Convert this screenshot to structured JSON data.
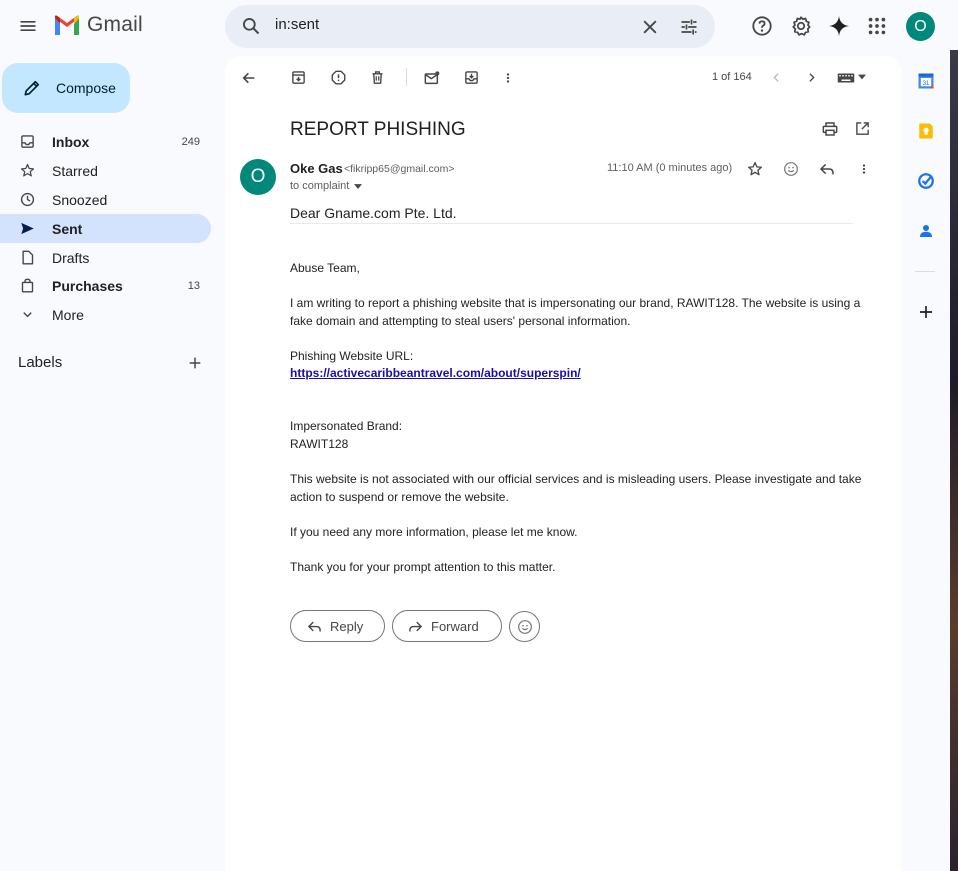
{
  "app": {
    "name": "Gmail"
  },
  "search": {
    "value": "in:sent"
  },
  "user": {
    "initial": "O"
  },
  "compose": {
    "label": "Compose"
  },
  "sidebar": {
    "items": [
      {
        "label": "Inbox",
        "count": "249"
      },
      {
        "label": "Starred",
        "count": ""
      },
      {
        "label": "Snoozed",
        "count": ""
      },
      {
        "label": "Sent",
        "count": ""
      },
      {
        "label": "Drafts",
        "count": ""
      },
      {
        "label": "Purchases",
        "count": "13"
      },
      {
        "label": "More",
        "count": ""
      }
    ],
    "labels_title": "Labels"
  },
  "toolbar": {
    "pager": "1 of 164"
  },
  "email": {
    "subject": "REPORT PHISHING",
    "sender_initial": "O",
    "sender_name": "Oke Gas",
    "sender_email": "<fikripp65@gmail.com>",
    "recipient": "to complaint",
    "timestamp": "11:10 AM (0 minutes ago)",
    "greeting": "Dear Gname.com Pte. Ltd.",
    "body": {
      "salutation": "Abuse Team,",
      "intro": "I am writing to report a phishing website that is impersonating our brand, RAWIT128. The website is using a fake domain and attempting to steal users' personal information.",
      "url_label": "Phishing Website URL:",
      "url": "https://activecaribbeantravel.com/about/superspin/",
      "brand_label": "Impersonated Brand:",
      "brand": "RAWIT128",
      "request": "This website is not associated with our official services and is misleading users. Please investigate and take action to suspend or remove the website.",
      "followup": "If you need any more information, please let me know.",
      "thanks": "Thank you for your prompt attention to this matter."
    }
  },
  "actions": {
    "reply": "Reply",
    "forward": "Forward"
  },
  "colors": {
    "accent": "#0b57d0",
    "compose_bg": "#c2e7ff",
    "active_nav": "#d3e3fd",
    "avatar": "#00897b",
    "link": "#1a0dab"
  }
}
